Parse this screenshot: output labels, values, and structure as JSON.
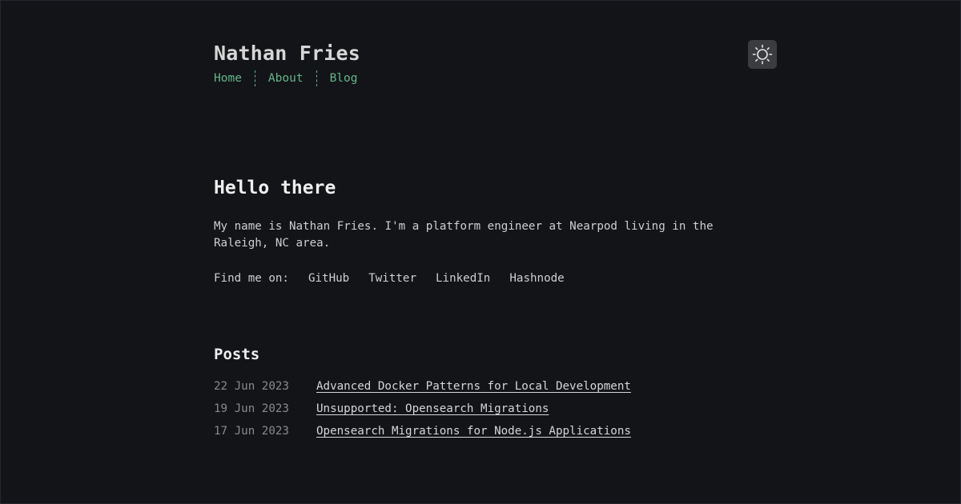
{
  "site": {
    "title": "Nathan Fries",
    "nav": [
      {
        "label": "Home"
      },
      {
        "label": "About"
      },
      {
        "label": "Blog"
      }
    ]
  },
  "theme_toggle": {
    "icon": "sun-icon"
  },
  "intro": {
    "heading": "Hello there",
    "text": "My name is Nathan Fries. I'm a platform engineer at Nearpod living in the Raleigh, NC area.",
    "find_label": "Find me on:",
    "links": [
      {
        "label": "GitHub"
      },
      {
        "label": "Twitter"
      },
      {
        "label": "LinkedIn"
      },
      {
        "label": "Hashnode"
      }
    ]
  },
  "posts": {
    "heading": "Posts",
    "items": [
      {
        "date": "22 Jun 2023",
        "title": "Advanced Docker Patterns for Local Development"
      },
      {
        "date": "19 Jun 2023",
        "title": "Unsupported: Opensearch Migrations"
      },
      {
        "date": "17 Jun 2023",
        "title": "Opensearch Migrations for Node.js Applications"
      }
    ]
  },
  "colors": {
    "background": "#131418",
    "accent": "#63b58a",
    "toggle_bg": "#3b3c40"
  }
}
